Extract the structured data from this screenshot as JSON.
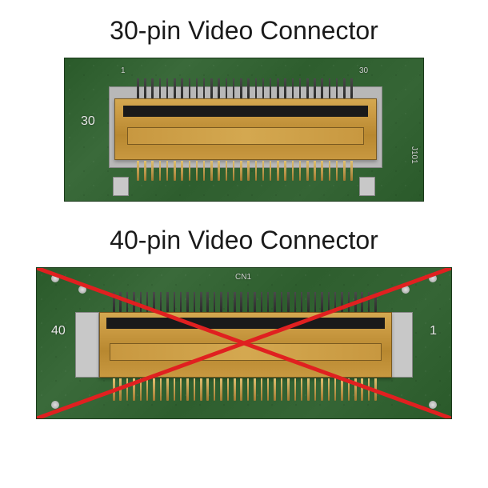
{
  "connector30": {
    "title": "30-pin Video Connector",
    "left_label": "30",
    "top_left_num": "1",
    "top_right_num": "30",
    "side_label": "J101",
    "pin_count": 30
  },
  "connector40": {
    "title": "40-pin Video Connector",
    "left_label": "40",
    "right_label": "1",
    "top_label": "CN1",
    "pin_count": 40,
    "crossed_out": true
  }
}
